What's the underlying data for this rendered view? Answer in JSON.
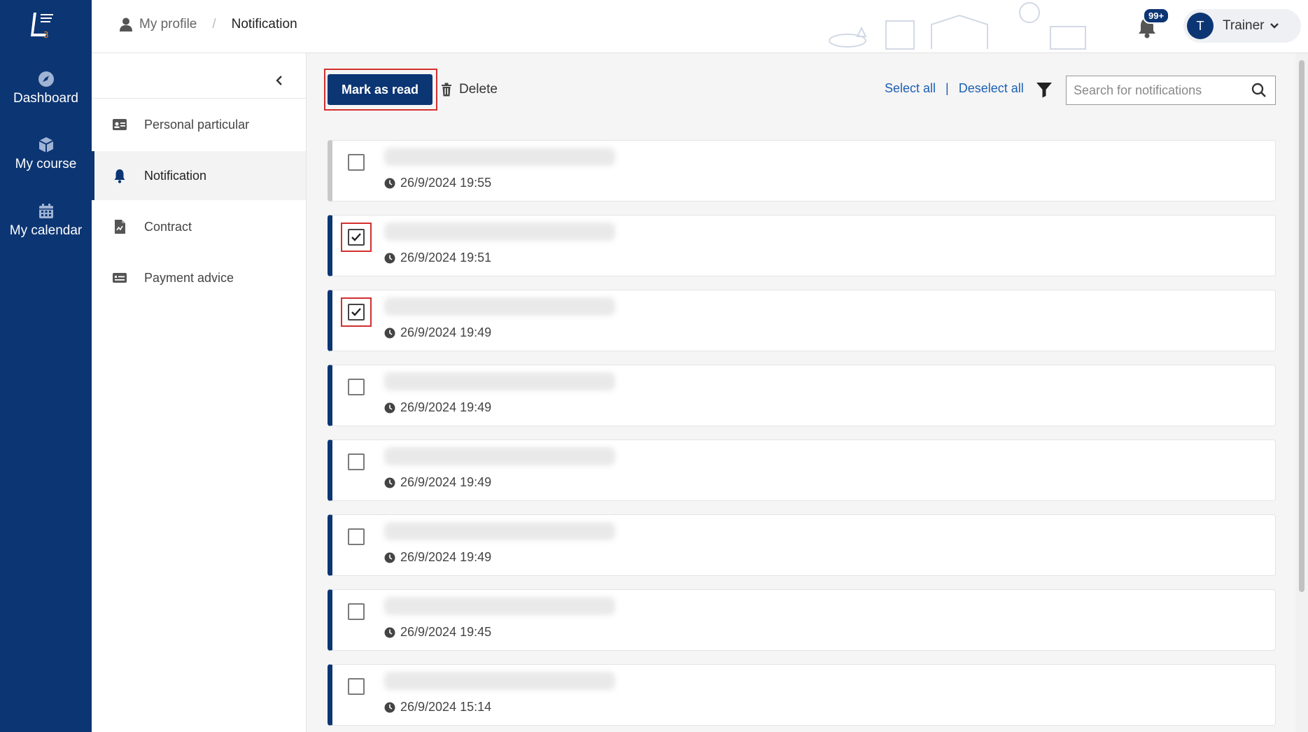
{
  "nav": {
    "items": [
      {
        "label": "Dashboard",
        "icon": "compass-icon"
      },
      {
        "label": "My course",
        "icon": "cube-icon"
      },
      {
        "label": "My calendar",
        "icon": "calendar-icon"
      }
    ]
  },
  "header": {
    "breadcrumb_parent": "My profile",
    "breadcrumb_sep": "/",
    "breadcrumb_current": "Notification",
    "notification_badge": "99+",
    "user_initial": "T",
    "user_name": "Trainer"
  },
  "profile_nav": {
    "items": [
      {
        "label": "Personal particular",
        "icon": "id-card-icon"
      },
      {
        "label": "Notification",
        "icon": "bell-icon",
        "active": true
      },
      {
        "label": "Contract",
        "icon": "document-icon"
      },
      {
        "label": "Payment advice",
        "icon": "payment-card-icon"
      }
    ]
  },
  "toolbar": {
    "mark_as_read": "Mark as read",
    "delete": "Delete",
    "select_all": "Select all",
    "link_sep": "|",
    "deselect_all": "Deselect all",
    "search_placeholder": "Search for notifications"
  },
  "notifications": [
    {
      "time": "26/9/2024 19:55",
      "checked": false,
      "read": true
    },
    {
      "time": "26/9/2024 19:51",
      "checked": true,
      "read": false
    },
    {
      "time": "26/9/2024 19:49",
      "checked": true,
      "read": false
    },
    {
      "time": "26/9/2024 19:49",
      "checked": false,
      "read": false
    },
    {
      "time": "26/9/2024 19:49",
      "checked": false,
      "read": false
    },
    {
      "time": "26/9/2024 19:49",
      "checked": false,
      "read": false
    },
    {
      "time": "26/9/2024 19:45",
      "checked": false,
      "read": false
    },
    {
      "time": "26/9/2024 15:14",
      "checked": false,
      "read": false
    }
  ],
  "colors": {
    "brand": "#0c3573",
    "link": "#1d5fb4",
    "highlight": "#d32f2f"
  }
}
